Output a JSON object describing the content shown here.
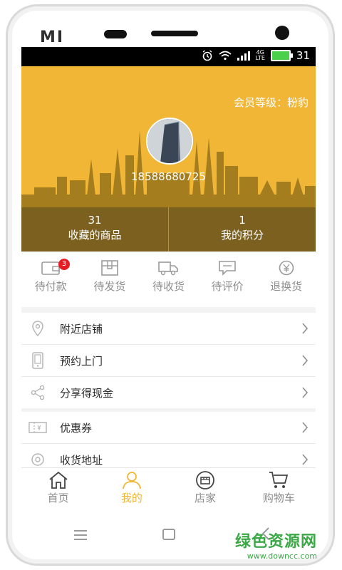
{
  "device": {
    "brand": "MI"
  },
  "statusbar": {
    "network": "4G",
    "network_sub": "LTE",
    "battery_level": "31"
  },
  "profile": {
    "member_level": "会员等级：粉豹",
    "phone": "18588680725",
    "stats": [
      {
        "value": "31",
        "label": "收藏的商品"
      },
      {
        "value": "1",
        "label": "我的积分"
      }
    ]
  },
  "orders": [
    {
      "label": "待付款",
      "icon": "wallet-icon",
      "badge": "3"
    },
    {
      "label": "待发货",
      "icon": "package-icon"
    },
    {
      "label": "待收货",
      "icon": "truck-icon"
    },
    {
      "label": "待评价",
      "icon": "comment-icon"
    },
    {
      "label": "退换货",
      "icon": "refund-icon"
    }
  ],
  "menu1": [
    {
      "label": "附近店铺",
      "icon": "location-pin-icon"
    },
    {
      "label": "预约上门",
      "icon": "mobile-phone-icon"
    },
    {
      "label": "分享得现金",
      "icon": "share-icon"
    }
  ],
  "menu2": [
    {
      "label": "优惠券",
      "icon": "coupon-icon"
    },
    {
      "label": "收货地址",
      "icon": "address-icon"
    }
  ],
  "tabbar": [
    {
      "label": "首页",
      "icon": "home-icon",
      "active": false
    },
    {
      "label": "我的",
      "icon": "user-icon",
      "active": true
    },
    {
      "label": "店家",
      "icon": "store-icon",
      "active": false
    },
    {
      "label": "购物车",
      "icon": "cart-icon",
      "active": false
    }
  ],
  "watermark": {
    "title": "绿色资源网",
    "url": "www.downcc.com"
  },
  "colors": {
    "accent": "#f2b636",
    "stats_bar": "#7b6020",
    "badge": "#e51c23",
    "watermark": "#3aa845"
  }
}
